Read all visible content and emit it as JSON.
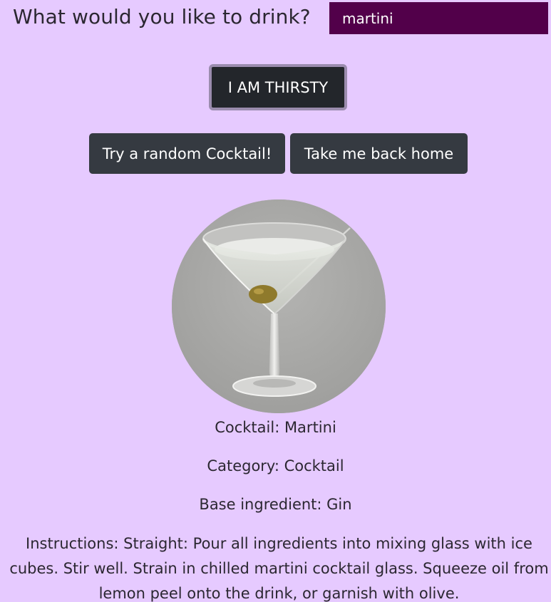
{
  "header": {
    "question": "What would you like to drink?"
  },
  "search": {
    "value": "martini"
  },
  "buttons": {
    "thirsty": "I AM THIRSTY",
    "random": "Try a random Cocktail!",
    "home": "Take me back home"
  },
  "drink": {
    "name_line": "Cocktail: Martini",
    "category_line": "Category: Cocktail",
    "base_line": "Base ingredient: Gin",
    "instructions_line": "Instructions: Straight: Pour all ingredients into mixing glass with ice cubes. Stir well. Strain in chilled martini cocktail glass. Squeeze oil from lemon peel onto the drink, or garnish with olive."
  },
  "colors": {
    "background": "#e6caff",
    "input_background": "#52004a",
    "button_dark": "#353a41",
    "button_primary": "#23262b",
    "button_focus_border": "#9b8cae"
  }
}
